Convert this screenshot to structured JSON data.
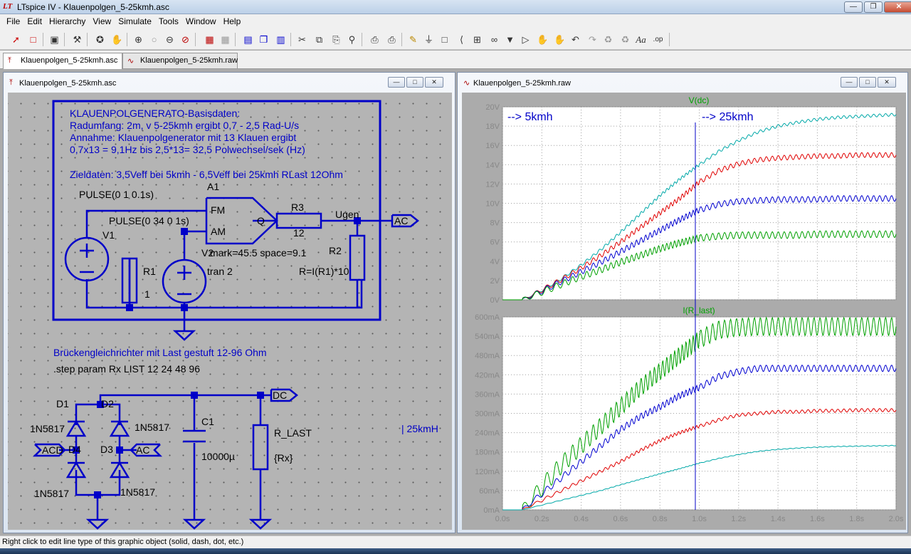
{
  "window": {
    "title": "LTspice IV - Klauenpolgen_5-25kmh.asc"
  },
  "menu": [
    "File",
    "Edit",
    "Hierarchy",
    "View",
    "Simulate",
    "Tools",
    "Window",
    "Help"
  ],
  "tabs": [
    {
      "label": "Klauenpolgen_5-25kmh.asc",
      "active": true
    },
    {
      "label": "Klauenpolgen_5-25kmh.raw",
      "active": false
    }
  ],
  "schematic": {
    "title": "Klauenpolgen_5-25kmh.asc",
    "notes": [
      "KLAUENPOLGENERATO-Basisdaten:",
      "Radumfang: 2m, v 5-25kmh ergibt 0,7 - 2,5 Rad-U/s",
      "Annahme: Klauenpolgenerator mit 13 Klauen ergibt",
      "0,7x13 = 9,1Hz bis 2,5*13= 32,5 Polwechsel/sek (Hz)",
      "Zieldaten: 3,5Veff bei 5kmh - 6,5Veff bei 25kmh RLast 12Ohm"
    ],
    "labels": {
      "pulse1": "PULSE(0 1 0.1s)",
      "a1": "A1",
      "fm": "FM",
      "am": "AM",
      "q": "Q",
      "v1": "V1",
      "pulse2": "PULSE(0 34 0 1s)",
      "r1": "R1",
      "r1val": "1",
      "v2": "V2",
      "v2space": "mark=45.5 space=9.1",
      "tran": "tran 2",
      "r3": "R3",
      "r3val": "12",
      "ugen": "Ugen",
      "ac_out": "AC",
      "r2": "R2",
      "r2val": "R=I(R1)*10",
      "bridge_note": "Brückengleichrichter mit Last gestuft 12-96 Ohm",
      "step": ".step param Rx LIST 12 24 48 96",
      "d1": "D1",
      "d2": "D2",
      "d3": "D3",
      "d4": "D4",
      "d1model": "1N5817",
      "d2model": "1N5817",
      "d3model": "1N5817",
      "d4model": "1N5817",
      "acd": "ACD",
      "ac_in": "AC",
      "dc": "DC",
      "c1": "C1",
      "c1val": "10000µ",
      "rlast": "R_LAST",
      "rx": "{Rx}",
      "note25": "| 25kmH"
    }
  },
  "waveform": {
    "title": "Klauenpolgen_5-25kmh.raw",
    "annotations": [
      "--> 5kmh",
      "--> 25kmh"
    ],
    "cursor_x": 0.98
  },
  "chart_data": [
    {
      "type": "line",
      "title": "V(dc)",
      "x": [
        0,
        0.1,
        0.2,
        0.3,
        0.4,
        0.5,
        0.6,
        0.7,
        0.8,
        0.9,
        1.0,
        1.1,
        1.2,
        1.3,
        1.4,
        1.5,
        1.6,
        1.7,
        1.8,
        1.9,
        2.0
      ],
      "xlabel_ticks": [
        "0.0s",
        "0.2s",
        "0.4s",
        "0.6s",
        "0.8s",
        "1.0s",
        "1.2s",
        "1.4s",
        "1.6s",
        "1.8s",
        "2.0s"
      ],
      "yticks": [
        "0V",
        "2V",
        "4V",
        "6V",
        "8V",
        "10V",
        "12V",
        "14V",
        "16V",
        "18V",
        "20V"
      ],
      "ylim": [
        0,
        20
      ],
      "xlim": [
        0,
        2
      ],
      "series": [
        {
          "color": "#00a8a8",
          "ripple": 0.15,
          "values": [
            0,
            0,
            1.0,
            2.2,
            3.6,
            5.2,
            7.0,
            8.9,
            10.8,
            12.5,
            14.0,
            15.4,
            16.5,
            17.4,
            18.0,
            18.4,
            18.7,
            18.9,
            19.0,
            19.1,
            19.2
          ]
        },
        {
          "color": "#e00000",
          "ripple": 0.25,
          "values": [
            0,
            0,
            1.0,
            2.1,
            3.3,
            4.6,
            6.0,
            7.5,
            9.0,
            10.5,
            12.2,
            13.4,
            14.1,
            14.5,
            14.7,
            14.8,
            14.9,
            14.9,
            15.0,
            15.0,
            15.0
          ]
        },
        {
          "color": "#0000d0",
          "ripple": 0.3,
          "values": [
            0,
            0,
            0.9,
            1.9,
            2.9,
            3.9,
            5.0,
            6.1,
            7.2,
            8.3,
            9.3,
            9.9,
            10.2,
            10.3,
            10.4,
            10.4,
            10.4,
            10.5,
            10.5,
            10.5,
            10.5
          ]
        },
        {
          "color": "#00a000",
          "ripple": 0.35,
          "values": [
            0,
            0,
            0.8,
            1.6,
            2.4,
            3.1,
            3.9,
            4.6,
            5.3,
            5.9,
            6.4,
            6.6,
            6.7,
            6.7,
            6.7,
            6.7,
            6.8,
            6.8,
            6.8,
            6.8,
            6.8
          ]
        }
      ]
    },
    {
      "type": "line",
      "title": "I(R_last)",
      "x": [
        0,
        0.1,
        0.2,
        0.3,
        0.4,
        0.5,
        0.6,
        0.7,
        0.8,
        0.9,
        1.0,
        1.1,
        1.2,
        1.3,
        1.4,
        1.5,
        1.6,
        1.7,
        1.8,
        1.9,
        2.0
      ],
      "xlabel_ticks": [
        "0.0s",
        "0.2s",
        "0.4s",
        "0.6s",
        "0.8s",
        "1.0s",
        "1.2s",
        "1.4s",
        "1.6s",
        "1.8s",
        "2.0s"
      ],
      "yticks": [
        "0mA",
        "60mA",
        "120mA",
        "180mA",
        "240mA",
        "300mA",
        "360mA",
        "420mA",
        "480mA",
        "540mA",
        "600mA"
      ],
      "ylim": [
        0,
        600
      ],
      "xlim": [
        0,
        2
      ],
      "series": [
        {
          "color": "#00a000",
          "ripple": 28,
          "values": [
            0,
            0,
            70,
            140,
            200,
            260,
            320,
            380,
            430,
            480,
            530,
            560,
            568,
            570,
            570,
            570,
            570,
            570,
            570,
            570,
            570
          ]
        },
        {
          "color": "#0000d0",
          "ripple": 10,
          "values": [
            0,
            0,
            50,
            100,
            150,
            200,
            250,
            290,
            320,
            355,
            380,
            415,
            430,
            440,
            440,
            440,
            440,
            440,
            440,
            440,
            440
          ]
        },
        {
          "color": "#e00000",
          "ripple": 5,
          "values": [
            0,
            0,
            30,
            60,
            90,
            120,
            150,
            185,
            215,
            240,
            260,
            280,
            295,
            300,
            305,
            305,
            308,
            308,
            310,
            310,
            310
          ]
        },
        {
          "color": "#00a8a8",
          "ripple": 1,
          "values": [
            0,
            0,
            15,
            30,
            45,
            60,
            78,
            95,
            112,
            128,
            145,
            160,
            172,
            182,
            188,
            192,
            195,
            197,
            198,
            199,
            200
          ]
        }
      ]
    }
  ],
  "status": "Right click to edit line type of this graphic object (solid, dash, dot, etc.)"
}
